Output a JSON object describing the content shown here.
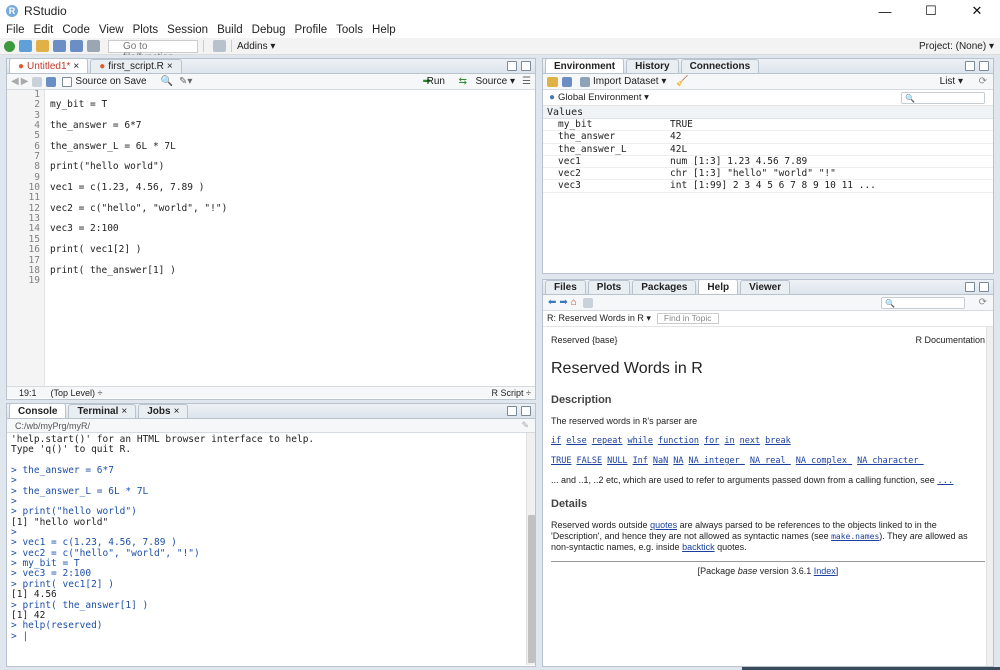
{
  "window": {
    "title": "RStudio",
    "minimize": "—",
    "maximize": "☐",
    "close": "✕"
  },
  "menu": [
    "File",
    "Edit",
    "Code",
    "View",
    "Plots",
    "Session",
    "Build",
    "Debug",
    "Profile",
    "Tools",
    "Help"
  ],
  "toolbar": {
    "goto_placeholder": "Go to file/function",
    "addins": "Addins ▾",
    "project": "Project: (None) ▾"
  },
  "editor": {
    "tabs": [
      {
        "label": "Untitled1*"
      },
      {
        "label": "first_script.R"
      }
    ],
    "source_on_save": "Source on Save",
    "run": "Run",
    "source": "Source ▾",
    "lines": [
      "",
      "my_bit = T",
      "",
      "the_answer = 6*7",
      "",
      "the_answer_L = 6L * 7L",
      "",
      "print(\"hello world\")",
      "",
      "vec1 = c(1.23, 4.56, 7.89 )",
      "",
      "vec2 = c(\"hello\", \"world\", \"!\")",
      "",
      "vec3 = 2:100",
      "",
      "print( vec1[2] )",
      "",
      "print( the_answer[1] )",
      ""
    ],
    "line_numbers": [
      "1",
      "2",
      "3",
      "4",
      "5",
      "6",
      "7",
      "8",
      "9",
      "10",
      "11",
      "12",
      "13",
      "14",
      "15",
      "16",
      "17",
      "18",
      "19"
    ],
    "status_pos": "19:1",
    "status_scope": "(Top Level) ÷",
    "status_type": "R Script ÷"
  },
  "console": {
    "tabs": [
      {
        "label": "Console"
      },
      {
        "label": "Terminal"
      },
      {
        "label": "Jobs"
      }
    ],
    "path": "C:/wb/myPrg/myR/",
    "lines": [
      {
        "t": "'help.start()' for an HTML browser interface to help.",
        "c": ""
      },
      {
        "t": "Type 'q()' to quit R.",
        "c": ""
      },
      {
        "t": "",
        "c": ""
      },
      {
        "t": "> the_answer = 6*7",
        "c": "blue"
      },
      {
        "t": ">",
        "c": "blue"
      },
      {
        "t": "> the_answer_L = 6L * 7L",
        "c": "blue"
      },
      {
        "t": ">",
        "c": "blue"
      },
      {
        "t": "> print(\"hello world\")",
        "c": "blue"
      },
      {
        "t": "[1] \"hello world\"",
        "c": ""
      },
      {
        "t": ">",
        "c": "blue"
      },
      {
        "t": "> vec1 = c(1.23, 4.56, 7.89 )",
        "c": "blue"
      },
      {
        "t": "> vec2 = c(\"hello\", \"world\", \"!\")",
        "c": "blue"
      },
      {
        "t": "> my_bit = T",
        "c": "blue"
      },
      {
        "t": "> vec3 = 2:100",
        "c": "blue"
      },
      {
        "t": "> print( vec1[2] )",
        "c": "blue"
      },
      {
        "t": "[1] 4.56",
        "c": ""
      },
      {
        "t": "> print( the_answer[1] )",
        "c": "blue"
      },
      {
        "t": "[1] 42",
        "c": ""
      },
      {
        "t": "> help(reserved)",
        "c": "blue"
      },
      {
        "t": "> |",
        "c": "blue"
      }
    ]
  },
  "env": {
    "tabs": [
      {
        "label": "Environment"
      },
      {
        "label": "History"
      },
      {
        "label": "Connections"
      }
    ],
    "import": "Import Dataset ▾",
    "list": "List ▾",
    "scope": "Global Environment ▾",
    "section": "Values",
    "rows": [
      {
        "name": "my_bit",
        "value": "TRUE"
      },
      {
        "name": "the_answer",
        "value": "42"
      },
      {
        "name": "the_answer_L",
        "value": "42L"
      },
      {
        "name": "vec1",
        "value": "num [1:3] 1.23 4.56 7.89"
      },
      {
        "name": "vec2",
        "value": "chr [1:3] \"hello\" \"world\" \"!\""
      },
      {
        "name": "vec3",
        "value": "int [1:99] 2 3 4 5 6 7 8 9 10 11 ..."
      }
    ]
  },
  "help": {
    "tabs": [
      {
        "label": "Files"
      },
      {
        "label": "Plots"
      },
      {
        "label": "Packages"
      },
      {
        "label": "Help"
      },
      {
        "label": "Viewer"
      }
    ],
    "topic": "R: Reserved Words in R ▾",
    "find_placeholder": "Find in Topic",
    "header_left": "Reserved {base}",
    "header_right": "R Documentation",
    "title": "Reserved Words in R",
    "description_h": "Description",
    "description_p1a": "The reserved words in ",
    "description_p1b": "R",
    "description_p1c": "'s parser are",
    "words1": [
      "if",
      "else",
      "repeat",
      "while",
      "function",
      "for",
      "in",
      "next",
      "break"
    ],
    "words2": [
      "TRUE",
      "FALSE",
      "NULL",
      "Inf",
      "NaN",
      "NA",
      "NA_integer_",
      "NA_real_",
      "NA_complex_",
      "NA_character_"
    ],
    "dots_text": "... and ..1, ..2 etc, which are used to refer to arguments passed down from a calling function, see ",
    "dots_link": "...",
    "details_h": "Details",
    "details_a": "Reserved words outside ",
    "details_link1": "quotes",
    "details_b": " are always parsed to be references to the objects linked to in the 'Description', and hence they are not allowed as syntactic names (see ",
    "details_link2": "make.names",
    "details_c": "). They ",
    "details_are": "are",
    "details_d": " allowed as non-syntactic names, e.g. inside ",
    "details_link3": "backtick",
    "details_e": " quotes.",
    "footer_a": "[Package ",
    "footer_pkg": "base",
    "footer_b": " version 3.6.1 ",
    "footer_link": "Index",
    "footer_c": "]"
  }
}
